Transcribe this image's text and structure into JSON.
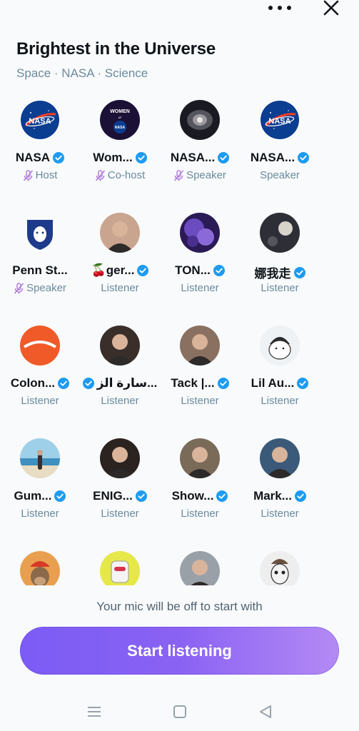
{
  "header": {
    "title": "Brightest in the Universe",
    "subtitle": "Space · NASA · Science",
    "more_icon": "more-horizontal-icon",
    "close_icon": "close-icon"
  },
  "participants": [
    {
      "name": "NASA",
      "role": "Host",
      "verified": true,
      "muted_mic": true,
      "avatar": "nasa-logo",
      "accent": "#0b3d91"
    },
    {
      "name": "Wom...",
      "role": "Co-host",
      "verified": true,
      "muted_mic": true,
      "avatar": "women-at-nasa-logo",
      "accent": "#1b1035"
    },
    {
      "name": "NASA...",
      "role": "Speaker",
      "verified": true,
      "muted_mic": true,
      "avatar": "galaxy-photo",
      "accent": "#2a2a3a"
    },
    {
      "name": "NASA...",
      "role": "Speaker",
      "verified": true,
      "muted_mic": false,
      "avatar": "nasa-logo",
      "accent": "#0b3d91"
    },
    {
      "name": "Penn St...",
      "role": "Speaker",
      "verified": false,
      "muted_mic": true,
      "avatar": "penn-state-shield",
      "accent": "#1e3a8a"
    },
    {
      "name": "🍒ger...",
      "role": "Listener",
      "verified": true,
      "muted_mic": false,
      "avatar": "person-photo",
      "accent": "#c9a58f"
    },
    {
      "name": "TON...",
      "role": "Listener",
      "verified": true,
      "muted_mic": false,
      "avatar": "nebula-photo",
      "accent": "#5b3fa0"
    },
    {
      "name": "娜我走",
      "role": "Listener",
      "verified": true,
      "muted_mic": false,
      "avatar": "moon-photo",
      "accent": "#3b3b44"
    },
    {
      "name": "Colon...",
      "role": "Listener",
      "verified": true,
      "muted_mic": false,
      "avatar": "orange-logo",
      "accent": "#f05a28"
    },
    {
      "name": "سارة الز...",
      "role": "Listener",
      "verified": true,
      "muted_mic": false,
      "avatar": "person-photo",
      "accent": "#3a2e2a",
      "badge_first": true
    },
    {
      "name": "Tack |...",
      "role": "Listener",
      "verified": true,
      "muted_mic": false,
      "avatar": "person-photo",
      "accent": "#8a7060"
    },
    {
      "name": "Lil Au...",
      "role": "Listener",
      "verified": true,
      "muted_mic": false,
      "avatar": "cartoon-avatar",
      "accent": "#e8eef2"
    },
    {
      "name": "Gum...",
      "role": "Listener",
      "verified": true,
      "muted_mic": false,
      "avatar": "beach-photo",
      "accent": "#8fc3e0"
    },
    {
      "name": "ENIG...",
      "role": "Listener",
      "verified": true,
      "muted_mic": false,
      "avatar": "person-photo",
      "accent": "#2b2320"
    },
    {
      "name": "Show...",
      "role": "Listener",
      "verified": true,
      "muted_mic": false,
      "avatar": "person-photo",
      "accent": "#7a6a58"
    },
    {
      "name": "Mark...",
      "role": "Listener",
      "verified": true,
      "muted_mic": false,
      "avatar": "person-photo",
      "accent": "#3b5a7a"
    },
    {
      "name": "",
      "role": "",
      "verified": false,
      "muted_mic": false,
      "avatar": "ape-nft",
      "accent": "#e8a050"
    },
    {
      "name": "",
      "role": "",
      "verified": false,
      "muted_mic": false,
      "avatar": "robot-nft",
      "accent": "#e6e84a"
    },
    {
      "name": "",
      "role": "",
      "verified": false,
      "muted_mic": false,
      "avatar": "person-photo",
      "accent": "#9aa0a8"
    },
    {
      "name": "",
      "role": "",
      "verified": false,
      "muted_mic": false,
      "avatar": "skeleton-nft",
      "accent": "#d8d8d8"
    }
  ],
  "footer": {
    "mic_note": "Your mic will be off to start with",
    "start_button": "Start listening"
  },
  "system_nav": [
    "menu-icon",
    "home-icon",
    "back-icon"
  ],
  "colors": {
    "verified": "#1d9bf0",
    "muted_mic": "#b07ad8",
    "secondary_text": "#6b8a9d",
    "button_gradient_start": "#7b5cf5",
    "button_gradient_end": "#b48af5"
  }
}
